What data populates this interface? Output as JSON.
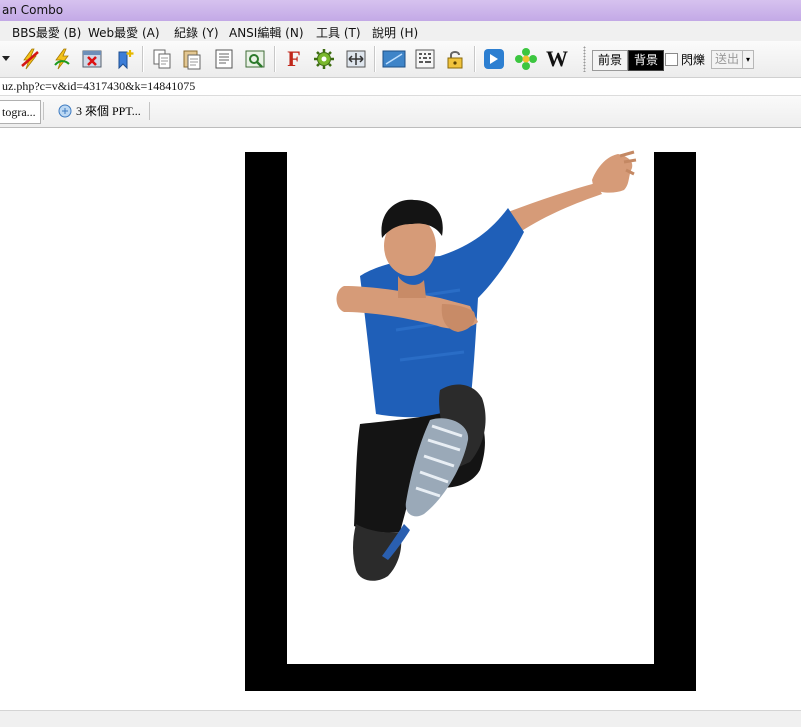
{
  "window": {
    "title": "an Combo"
  },
  "menu": [
    {
      "label": "BBS最愛 (B)"
    },
    {
      "label": "Web最愛 (A)"
    },
    {
      "label": "紀錄 (Y)"
    },
    {
      "label": "ANSI編輯 (N)"
    },
    {
      "label": "工具 (T)"
    },
    {
      "label": "說明 (H)"
    }
  ],
  "toolbar": {
    "icons": [
      "disconnect-icon",
      "reconnect-icon",
      "close-tab-icon",
      "add-favorite-icon",
      "copy-icon",
      "paste-icon",
      "copy-article-icon",
      "view-image-icon",
      "font-icon",
      "settings-icon",
      "fullscreen-icon",
      "screen-icon",
      "ascii-art-icon",
      "lock-icon",
      "compass-icon",
      "flower-icon",
      "wikipedia-icon"
    ],
    "fg_label": "前景",
    "bg_label": "背景",
    "blink_label": "閃爍",
    "send_label": "送出",
    "wiki_glyph": "W",
    "font_glyph": "F"
  },
  "address": {
    "url": "uz.php?c=v&id=4317430&k=14841075"
  },
  "tabs": [
    {
      "label": "togra..."
    },
    {
      "label": "3 來個 PPT..."
    }
  ],
  "colors": {
    "title_bar": "#c3a9e6",
    "frame": "#000000",
    "shirt": "#1f5fb8"
  }
}
